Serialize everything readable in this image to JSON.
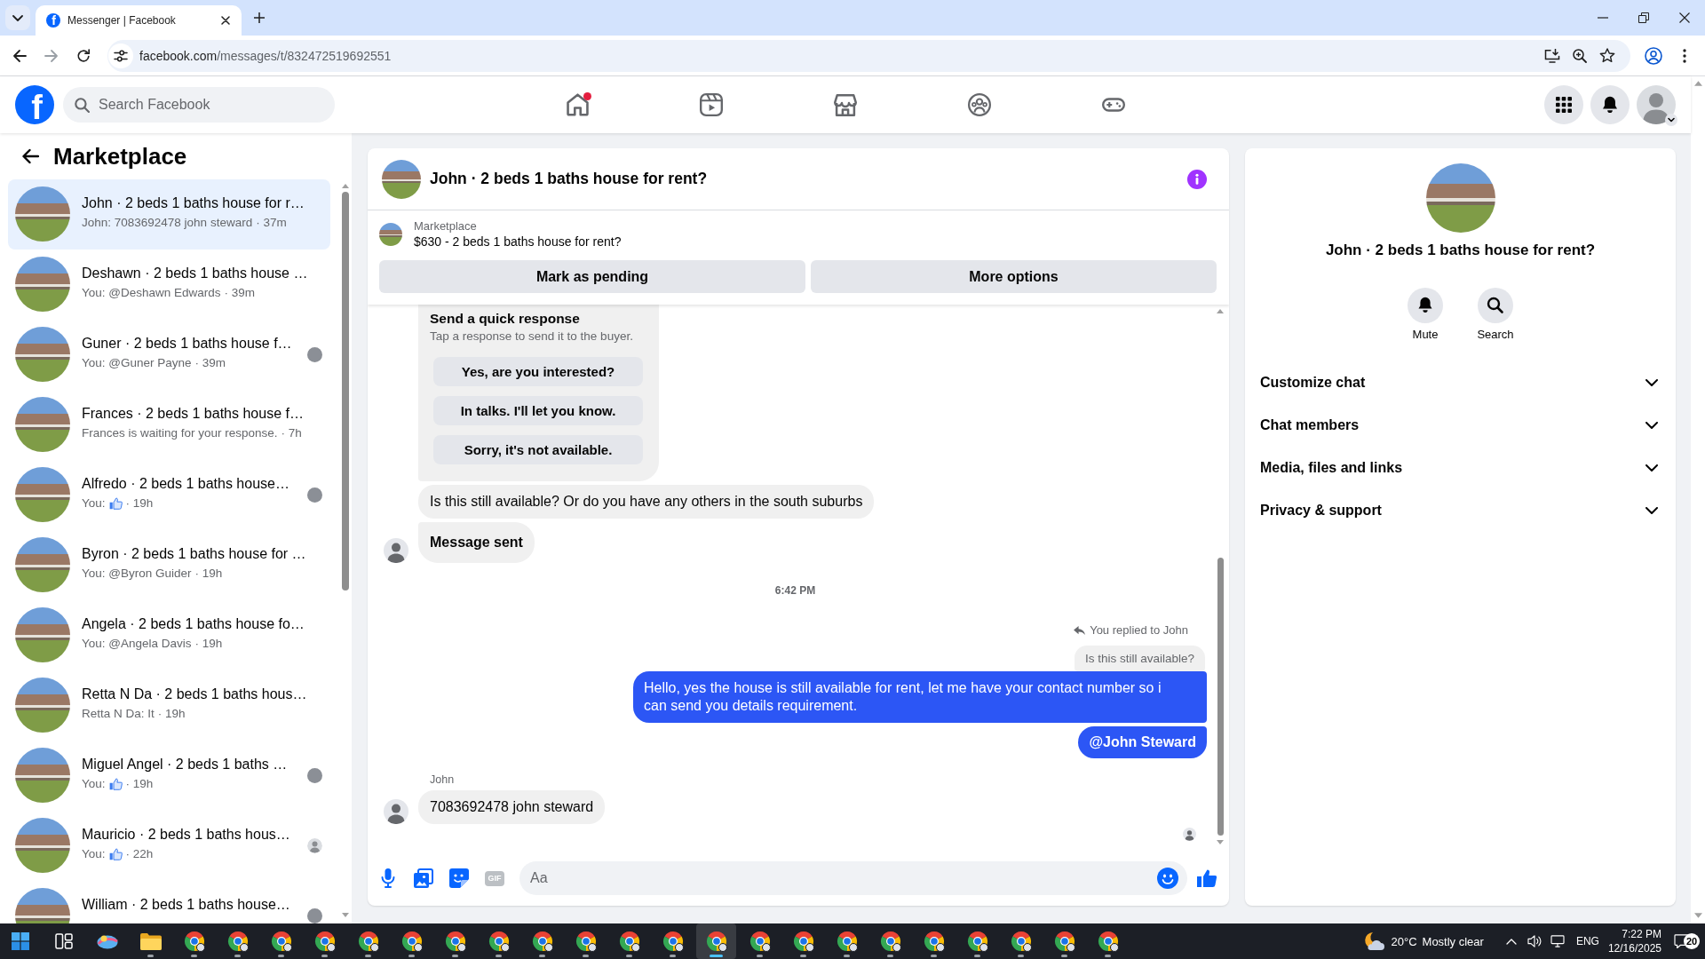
{
  "browser": {
    "tabs": [
      {
        "favicon": "f",
        "title": "Messenger | Facebook",
        "selected": true
      }
    ],
    "url": {
      "host": "facebook.com",
      "path": "/messages/t/832472519692551"
    }
  },
  "header": {
    "logo": "f",
    "search": {
      "placeholder": "Search Facebook"
    },
    "nav": [
      {
        "kind": "home",
        "selected": false,
        "badge": true
      },
      {
        "kind": "video",
        "selected": false,
        "badge": false
      },
      {
        "kind": "marketplace",
        "selected": false,
        "badge": false
      },
      {
        "kind": "groups",
        "selected": false,
        "badge": false
      },
      {
        "kind": "gaming",
        "selected": false,
        "badge": false
      }
    ]
  },
  "sidebar": {
    "title": "Marketplace",
    "conversations": [
      {
        "title": "John · 2 beds 1 baths house for r…",
        "preview": "John: 7083692478 john steward",
        "time": "· 37m",
        "selected": true,
        "liked": false
      },
      {
        "title": "Deshawn · 2 beds 1 baths house …",
        "preview": "You: @Deshawn Edwards",
        "time": "· 39m",
        "selected": false,
        "liked": false
      },
      {
        "title": "Guner · 2 beds 1 baths house f…",
        "preview": "You: @Guner Payne",
        "time": "· 39m",
        "selected": false,
        "liked": false,
        "seen": {
          "kind": "photo"
        }
      },
      {
        "title": "Frances · 2 beds 1 baths house f…",
        "preview": "Frances is waiting for your response.",
        "time": "· 7h",
        "selected": false,
        "liked": false
      },
      {
        "title": "Alfredo · 2 beds 1 baths house…",
        "preview": "You:",
        "time": "· 19h",
        "selected": false,
        "liked": true,
        "seen": {
          "kind": "photo"
        }
      },
      {
        "title": "Byron · 2 beds 1 baths house for …",
        "preview": "You: @Byron Guider",
        "time": "· 19h",
        "selected": false,
        "liked": false
      },
      {
        "title": "Angela · 2 beds 1 baths house fo…",
        "preview": "You: @Angela Davis",
        "time": "· 19h",
        "selected": false,
        "liked": false
      },
      {
        "title": "Retta N Da · 2 beds 1 baths hous…",
        "preview": "Retta N Da: It",
        "time": "· 19h",
        "selected": false,
        "liked": false
      },
      {
        "title": "Miguel Angel · 2 beds 1 baths …",
        "preview": "You:",
        "time": "· 19h",
        "selected": false,
        "liked": true,
        "seen": {
          "kind": "photo"
        }
      },
      {
        "title": "Mauricio · 2 beds 1 baths hous…",
        "preview": "You:",
        "time": "· 22h",
        "selected": false,
        "liked": true,
        "seen": {
          "kind": "silhouette"
        }
      },
      {
        "title": "William · 2 beds 1 baths house…",
        "selected": false,
        "seen": {
          "kind": "photo"
        }
      }
    ]
  },
  "chat": {
    "title": "John · 2 beds 1 baths house for rent?",
    "listing": {
      "label": "Marketplace",
      "text": "$630 - 2 beds 1 baths house for rent?"
    },
    "actions": [
      "Mark as pending",
      "More options"
    ],
    "messages": [
      {
        "kind": "quick_response",
        "title": "Send a quick response",
        "hint": "Tap a response to send it to the buyer.",
        "options": [
          "Yes, are you interested?",
          "In talks. I'll let you know.",
          "Sorry, it's not available."
        ]
      },
      {
        "kind": "incoming",
        "text": "Is this still available? Or do you have any others in the south suburbs",
        "avatar": false
      },
      {
        "kind": "notice",
        "text": "Message sent",
        "avatar": true
      },
      {
        "kind": "timestamp",
        "text": "6:42 PM"
      },
      {
        "kind": "reply_note",
        "text": "You replied to John"
      },
      {
        "kind": "quoted",
        "text": "Is this still available?"
      },
      {
        "kind": "outgoing",
        "text": "Hello, yes the house is still available for rent, let me have your contact number so i can send you details requirement."
      },
      {
        "kind": "mention",
        "text": "@John Steward"
      },
      {
        "kind": "sender",
        "text": "John"
      },
      {
        "kind": "incoming",
        "text": "7083692478 john steward",
        "avatar": true
      },
      {
        "kind": "seen"
      }
    ],
    "composer": {
      "tools": [
        {
          "kind": "mic",
          "disabled": false
        },
        {
          "kind": "photo",
          "disabled": false
        },
        {
          "kind": "sticker",
          "disabled": false
        },
        {
          "kind": "gif",
          "label": "GIF",
          "disabled": true
        }
      ],
      "placeholder": "Aa"
    }
  },
  "info_panel": {
    "title": "John · 2 beds 1 baths house for rent?",
    "actions": [
      {
        "kind": "mute",
        "label": "Mute"
      },
      {
        "kind": "search",
        "label": "Search"
      }
    ],
    "sections": [
      {
        "label": "Customize chat",
        "expanded": false
      },
      {
        "label": "Chat members",
        "expanded": false
      },
      {
        "label": "Media, files and links",
        "expanded": false
      },
      {
        "label": "Privacy & support",
        "expanded": false
      }
    ]
  },
  "taskbar": {
    "apps": [
      {
        "kind": "start",
        "selected": false,
        "running": false
      },
      {
        "kind": "task_view",
        "selected": false,
        "running": false
      },
      {
        "kind": "app",
        "selected": false,
        "running": false
      },
      {
        "kind": "explorer",
        "selected": false,
        "running": true
      },
      {
        "kind": "browser",
        "selected": false,
        "running": true
      },
      {
        "kind": "browser",
        "selected": false,
        "running": true
      },
      {
        "kind": "browser",
        "selected": false,
        "running": true
      },
      {
        "kind": "browser",
        "selected": false,
        "running": true
      },
      {
        "kind": "browser",
        "selected": false,
        "running": true
      },
      {
        "kind": "browser",
        "selected": false,
        "running": true
      },
      {
        "kind": "browser",
        "selected": false,
        "running": true
      },
      {
        "kind": "browser",
        "selected": false,
        "running": true
      },
      {
        "kind": "browser",
        "selected": false,
        "running": true
      },
      {
        "kind": "browser",
        "selected": false,
        "running": true
      },
      {
        "kind": "browser",
        "selected": false,
        "running": true
      },
      {
        "kind": "browser",
        "selected": false,
        "running": true
      },
      {
        "kind": "browser",
        "selected": true,
        "running": true
      },
      {
        "kind": "browser",
        "selected": false,
        "running": true
      },
      {
        "kind": "browser",
        "selected": false,
        "running": true
      },
      {
        "kind": "browser",
        "selected": false,
        "running": true
      },
      {
        "kind": "browser",
        "selected": false,
        "running": true
      },
      {
        "kind": "browser",
        "selected": false,
        "running": true
      },
      {
        "kind": "browser",
        "selected": false,
        "running": true
      },
      {
        "kind": "browser",
        "selected": false,
        "running": true
      },
      {
        "kind": "browser",
        "selected": false,
        "running": true
      },
      {
        "kind": "browser",
        "selected": false,
        "running": true
      }
    ],
    "weather": {
      "temperature": "20°C",
      "condition": "Mostly clear"
    },
    "language": "ENG",
    "time": "7:22 PM",
    "date": "12/16/2025",
    "notifications": "20"
  }
}
